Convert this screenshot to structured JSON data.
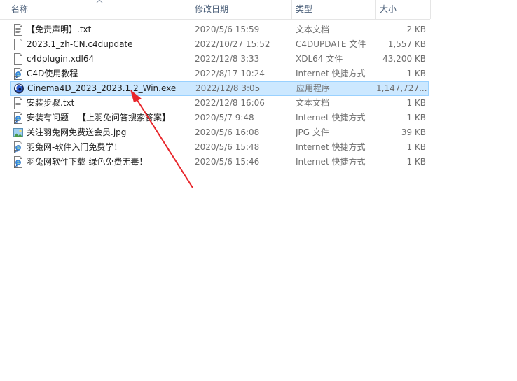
{
  "columns": {
    "name": "名称",
    "date": "修改日期",
    "type": "类型",
    "size": "大小"
  },
  "files": [
    {
      "name": "【免责声明】.txt",
      "date": "2020/5/6 15:59",
      "type": "文本文档",
      "size": "2 KB",
      "icon": "text-file-icon"
    },
    {
      "name": "2023.1_zh-CN.c4dupdate",
      "date": "2022/10/27 15:52",
      "type": "C4DUPDATE 文件",
      "size": "1,557 KB",
      "icon": "blank-file-icon"
    },
    {
      "name": "c4dplugin.xdl64",
      "date": "2022/12/8 3:33",
      "type": "XDL64 文件",
      "size": "43,200 KB",
      "icon": "blank-file-icon"
    },
    {
      "name": "C4D使用教程",
      "date": "2022/8/17 10:24",
      "type": "Internet 快捷方式",
      "size": "1 KB",
      "icon": "internet-shortcut-icon"
    },
    {
      "name": "Cinema4D_2023_2023.1.2_Win.exe",
      "date": "2022/12/8 3:05",
      "type": "应用程序",
      "size": "1,147,727...",
      "icon": "cinema4d-app-icon",
      "selected": true
    },
    {
      "name": "安装步骤.txt",
      "date": "2022/12/8 16:06",
      "type": "文本文档",
      "size": "1 KB",
      "icon": "text-file-icon"
    },
    {
      "name": "安装有问题---【上羽免问答搜索答案】",
      "date": "2020/5/7 9:48",
      "type": "Internet 快捷方式",
      "size": "1 KB",
      "icon": "internet-shortcut-icon"
    },
    {
      "name": "关注羽兔网免费送会员.jpg",
      "date": "2020/5/6 16:08",
      "type": "JPG 文件",
      "size": "39 KB",
      "icon": "image-file-icon"
    },
    {
      "name": "羽兔网-软件入门免费学！",
      "date": "2020/5/6 15:48",
      "type": "Internet 快捷方式",
      "size": "1 KB",
      "icon": "internet-shortcut-icon"
    },
    {
      "name": "羽兔网软件下载-绿色免费无毒！",
      "date": "2020/5/6 15:46",
      "type": "Internet 快捷方式",
      "size": "1 KB",
      "icon": "internet-shortcut-icon"
    }
  ],
  "colors": {
    "selection_bg": "#cce8ff",
    "selection_border": "#99d1ff",
    "header_text": "#4c607a",
    "annotation_arrow": "#e8262b"
  }
}
